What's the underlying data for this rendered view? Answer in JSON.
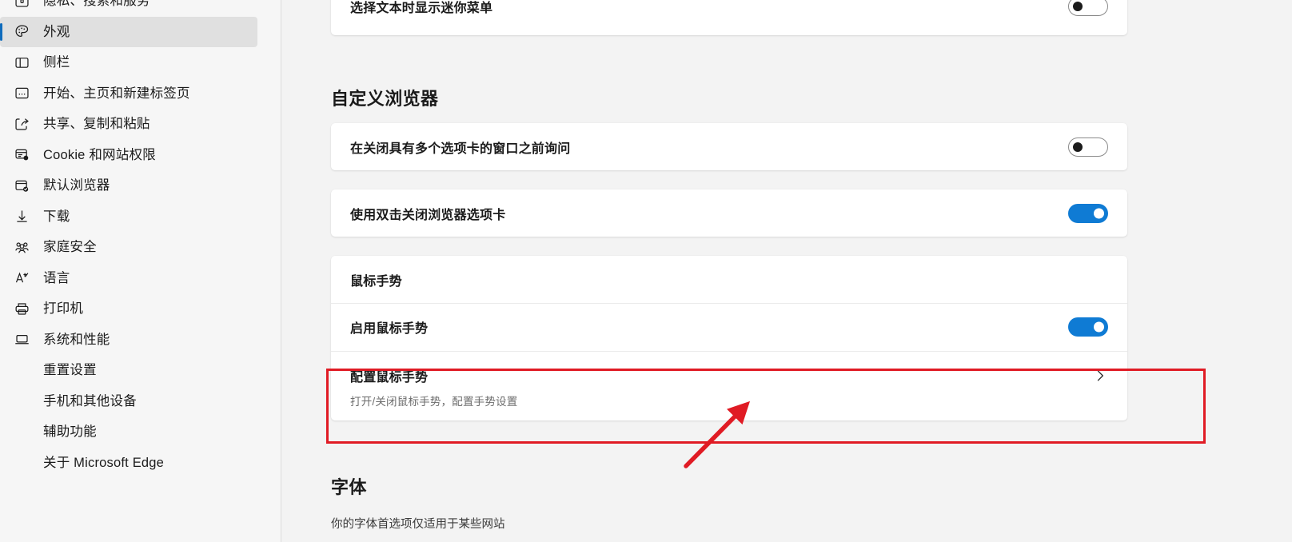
{
  "app": {
    "name": "Microsoft Edge Settings",
    "accent_blue": "#0f7bd4",
    "selection_bar": "#0f6cbd",
    "annotation_red": "#e01b24",
    "desktop_panel_blue": "#2a7ab0"
  },
  "sidebar": {
    "items": [
      {
        "label": "隐私、搜索和服务",
        "icon": "privacy-lock-icon",
        "selected": false,
        "partial": true
      },
      {
        "label": "外观",
        "icon": "palette-icon",
        "selected": true
      },
      {
        "label": "侧栏",
        "icon": "sidebar-panel-icon",
        "selected": false
      },
      {
        "label": "开始、主页和新建标签页",
        "icon": "home-page-icon",
        "selected": false
      },
      {
        "label": "共享、复制和粘贴",
        "icon": "share-icon",
        "selected": false
      },
      {
        "label": "Cookie 和网站权限",
        "icon": "cookie-permissions-icon",
        "selected": false
      },
      {
        "label": "默认浏览器",
        "icon": "default-browser-check-icon",
        "selected": false
      },
      {
        "label": "下载",
        "icon": "download-arrow-icon",
        "selected": false
      },
      {
        "label": "家庭安全",
        "icon": "family-people-icon",
        "selected": false
      },
      {
        "label": "语言",
        "icon": "language-letter-icon",
        "selected": false
      },
      {
        "label": "打印机",
        "icon": "printer-icon",
        "selected": false
      },
      {
        "label": "系统和性能",
        "icon": "laptop-icon",
        "selected": false
      },
      {
        "label": "重置设置",
        "icon": "reset-refresh-icon",
        "selected": false
      },
      {
        "label": "手机和其他设备",
        "icon": "phone-devices-icon",
        "selected": false
      },
      {
        "label": "辅助功能",
        "icon": "accessibility-icon",
        "selected": false
      },
      {
        "label": "关于 Microsoft Edge",
        "icon": "edge-logo-icon",
        "selected": false
      }
    ]
  },
  "desktop_panel": {
    "icons": [
      {
        "name": "windows-security-shield-icon"
      },
      {
        "name": "phone-link-icon"
      },
      {
        "name": "search-magnifier-icon"
      },
      {
        "name": "dimmed-app-icon"
      }
    ]
  },
  "main": {
    "top_card": {
      "title": "选择文本时显示迷你菜单",
      "toggle_state": "off"
    },
    "customize_section": {
      "heading": "自定义浏览器",
      "cards": [
        {
          "title": "在关闭具有多个选项卡的窗口之前询问",
          "toggle_state": "off"
        },
        {
          "title": "使用双击关闭浏览器选项卡",
          "toggle_state": "on"
        }
      ],
      "gesture_card": {
        "header_title": "鼠标手势",
        "enable_row": {
          "title": "启用鼠标手势",
          "toggle_state": "on"
        },
        "configure_row": {
          "title": "配置鼠标手势",
          "subtitle": "打开/关闭鼠标手势，配置手势设置",
          "chevron": "chevron-right-icon"
        }
      }
    },
    "fonts_section": {
      "heading": "字体",
      "description": "你的字体首选项仅适用于某些网站"
    }
  },
  "annotations": {
    "highlight_box": {
      "name": "configure-gestures-highlight-box"
    },
    "arrow": {
      "name": "pointer-arrow-to-configure-gestures"
    }
  }
}
